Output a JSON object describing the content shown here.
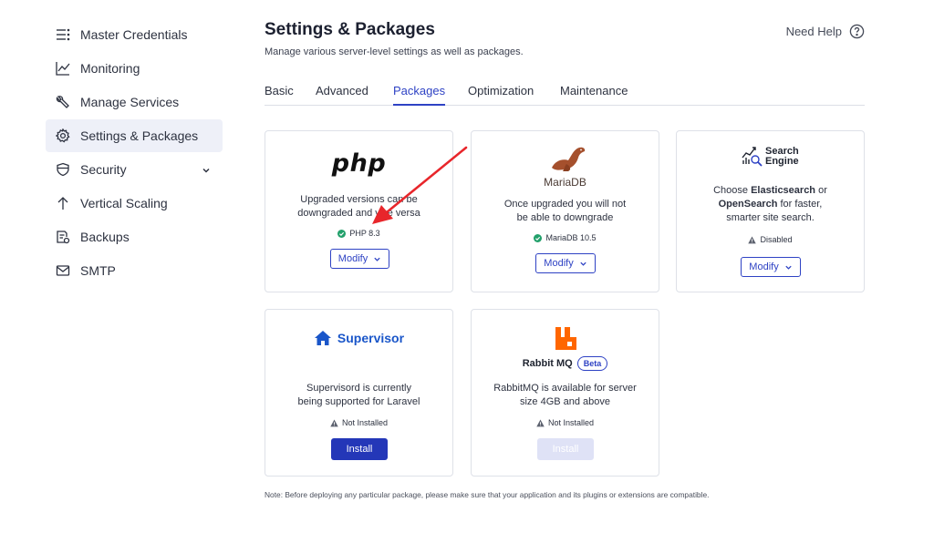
{
  "sidebar": {
    "items": [
      {
        "label": "Master Credentials",
        "icon": "list-icon"
      },
      {
        "label": "Monitoring",
        "icon": "chart-line-icon"
      },
      {
        "label": "Manage Services",
        "icon": "wrench-icon"
      },
      {
        "label": "Settings & Packages",
        "icon": "gear-icon",
        "active": true
      },
      {
        "label": "Security",
        "icon": "shield-icon"
      },
      {
        "label": "Vertical Scaling",
        "icon": "arrow-up-icon"
      },
      {
        "label": "Backups",
        "icon": "backup-icon"
      },
      {
        "label": "SMTP",
        "icon": "mail-icon"
      }
    ]
  },
  "header": {
    "title": "Settings & Packages",
    "subtitle": "Manage various server-level settings as well as packages.",
    "help": "Need Help"
  },
  "tabs": [
    "Basic",
    "Advanced",
    "Packages",
    "Optimization",
    "Maintenance"
  ],
  "active_tab": "Packages",
  "cards": {
    "php": {
      "logo": "php",
      "desc_line1": "Upgraded versions can be",
      "desc_line2": "downgraded and vice versa",
      "status": "PHP 8.3",
      "button": "Modify"
    },
    "mariadb": {
      "logo": "MariaDB",
      "desc_line1": "Once upgraded you will not",
      "desc_line2": "be able to downgrade",
      "status": "MariaDB 10.5",
      "button": "Modify"
    },
    "search": {
      "logo_line1": "Search",
      "logo_line2": "Engine",
      "desc_pre": "Choose ",
      "desc_bold1": "Elasticsearch",
      "desc_mid": " or",
      "desc_bold2": "OpenSearch",
      "desc_post": " for faster,",
      "desc_line3": "smarter site search.",
      "status": "Disabled",
      "button": "Modify"
    },
    "supervisor": {
      "logo": "Supervisor",
      "desc_line1": "Supervisord is currently",
      "desc_line2": "being supported for Laravel",
      "status": "Not Installed",
      "button": "Install"
    },
    "rabbitmq": {
      "title": "Rabbit MQ",
      "badge": "Beta",
      "desc_line1": "RabbitMQ is available for server",
      "desc_line2": "size 4GB and above",
      "status": "Not Installed",
      "button": "Install"
    }
  },
  "note": "Note: Before deploying any particular package, please make sure that your application and its plugins or extensions are compatible.",
  "colors": {
    "accent": "#2e42c4",
    "success": "#22a06b",
    "annotation_arrow": "#e8262b",
    "rabbitmq": "#ff6600",
    "supervisor": "#1a56c9"
  }
}
